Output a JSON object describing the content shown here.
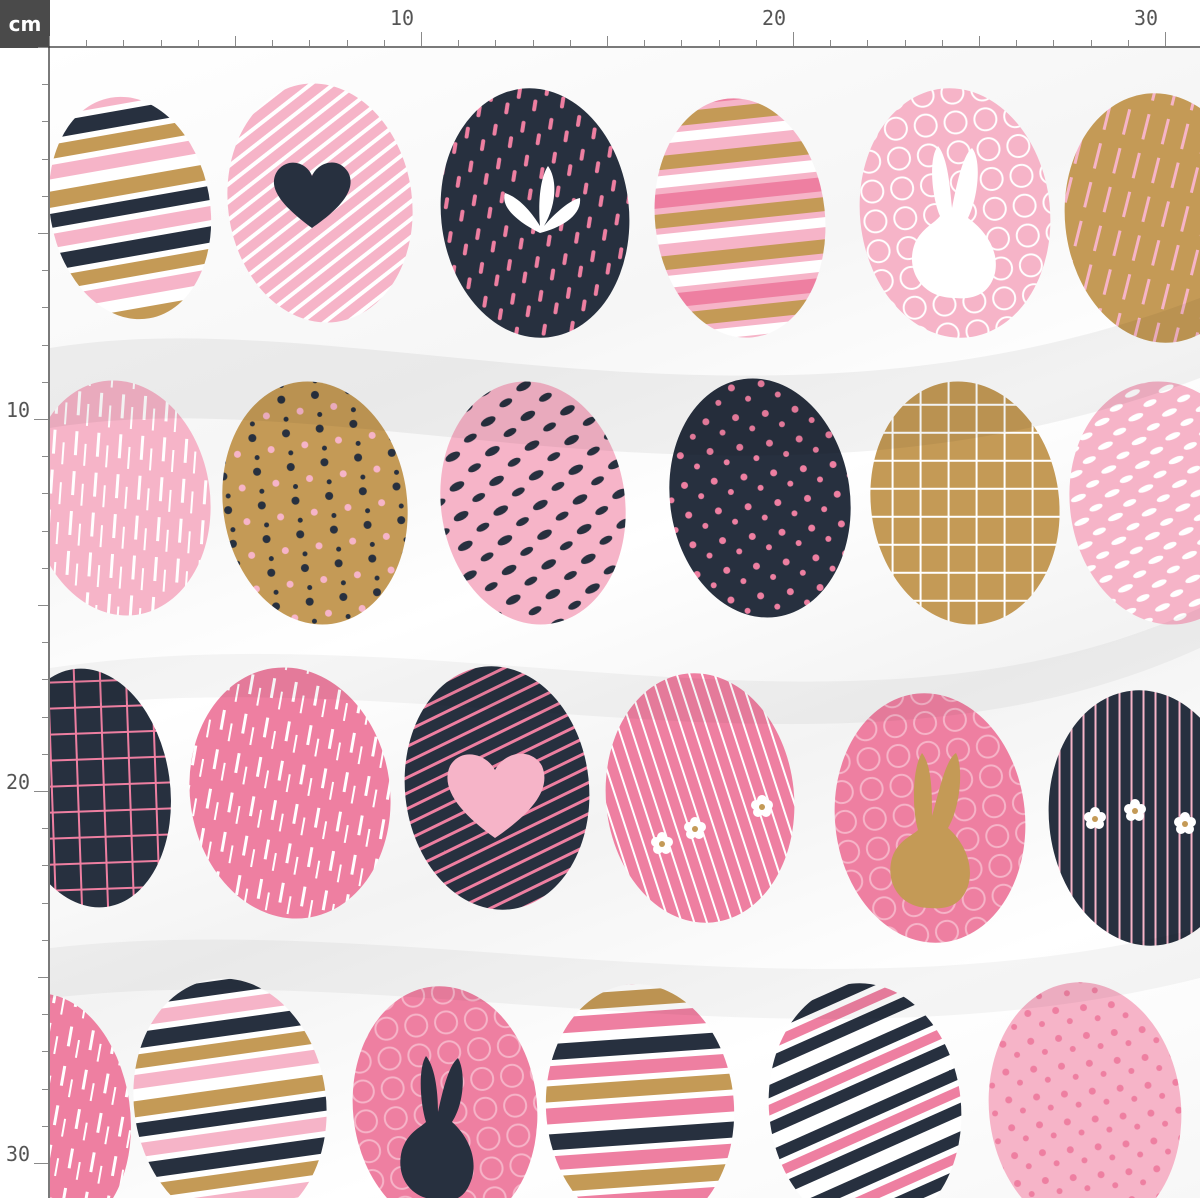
{
  "ruler": {
    "unit_label": "cm",
    "top_labels": [
      "10",
      "20",
      "30"
    ],
    "left_labels": [
      "10",
      "20",
      "30"
    ]
  },
  "colors": {
    "navy": "#27303f",
    "gold": "#c49a56",
    "pink": "#f6b4c8",
    "hot_pink": "#ee7fa1",
    "white": "#ffffff"
  },
  "eggs": [
    {
      "pattern": "stripes-gold-navy-pink"
    },
    {
      "pattern": "pink-diagonal-lines-heart"
    },
    {
      "pattern": "navy-pink-dashes-leaf"
    },
    {
      "pattern": "stripes-gold-pink"
    },
    {
      "pattern": "pink-scribble-bunny"
    },
    {
      "pattern": "gold-pink-scratches"
    },
    {
      "pattern": "pink-white-scratches"
    },
    {
      "pattern": "gold-dots"
    },
    {
      "pattern": "pink-navy-spots"
    },
    {
      "pattern": "navy-pink-dots"
    },
    {
      "pattern": "gold-white-grid"
    },
    {
      "pattern": "pink-white-dashes"
    },
    {
      "pattern": "navy-pink-grid"
    },
    {
      "pattern": "hot-pink-scratches"
    },
    {
      "pattern": "navy-pink-stripes-heart"
    },
    {
      "pattern": "pink-lines-flowers"
    },
    {
      "pattern": "pink-scribble-gold-bunny"
    },
    {
      "pattern": "navy-pink-lines-flowers"
    },
    {
      "pattern": "pink-scratches-edge"
    },
    {
      "pattern": "stripes-gold-navy-pink-2"
    },
    {
      "pattern": "pink-scribble-navy-bunny"
    },
    {
      "pattern": "stripes-navy-pink-gold"
    },
    {
      "pattern": "stripes-navy-white-pink"
    },
    {
      "pattern": "pink-hotpink-dots"
    }
  ]
}
